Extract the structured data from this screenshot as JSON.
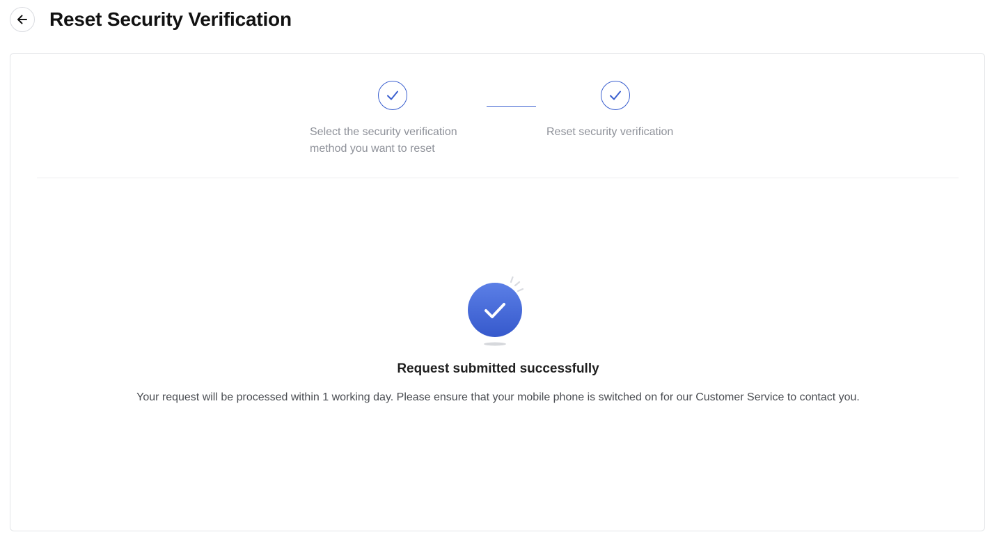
{
  "header": {
    "title": "Reset Security Verification",
    "back_icon": "arrow-left-icon"
  },
  "steps": [
    {
      "label_line1": "Select the security verification",
      "label_line2": "method you want to reset",
      "status": "completed",
      "icon": "check-icon"
    },
    {
      "label": "Reset security verification",
      "status": "completed",
      "icon": "check-icon"
    }
  ],
  "result": {
    "icon": "success-check-icon",
    "title": "Request submitted successfully",
    "message": "Your request will be processed within 1 working day. Please ensure that your mobile phone is switched on for our Customer Service to contact you."
  },
  "colors": {
    "accent": "#3a5fcf",
    "success_gradient_top": "#5b7fe6",
    "success_gradient_bottom": "#3659cc"
  }
}
